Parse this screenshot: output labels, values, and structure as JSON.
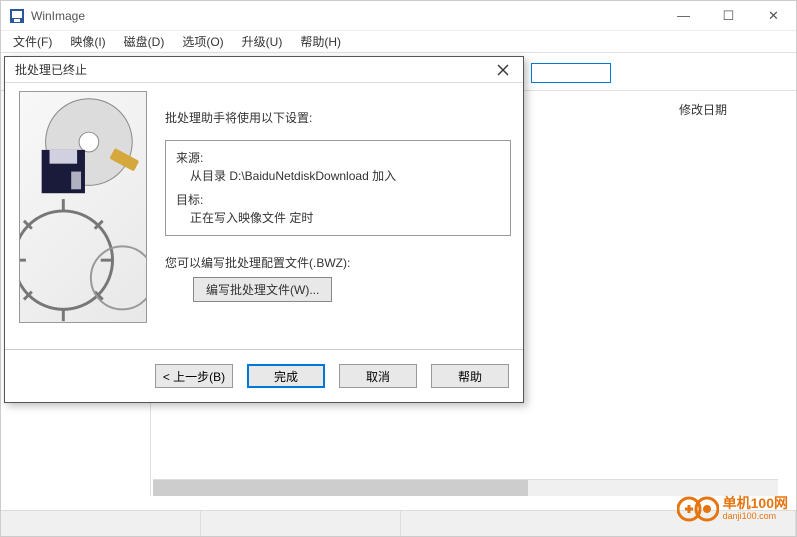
{
  "window": {
    "title": "WinImage",
    "controls": {
      "min": "—",
      "max": "☐",
      "close": "✕"
    }
  },
  "menu": {
    "items": [
      "文件(F)",
      "映像(I)",
      "磁盘(D)",
      "选项(O)",
      "升级(U)",
      "帮助(H)"
    ]
  },
  "columns": {
    "modified": "修改日期"
  },
  "dialog": {
    "title": "批处理已终止",
    "intro": "批处理助手将使用以下设置:",
    "source_label": "来源:",
    "source_value": "从目录 D:\\BaiduNetdiskDownload 加入",
    "target_label": "目标:",
    "target_value": "正在写入映像文件 定时",
    "config_label": "您可以编写批处理配置文件(.BWZ):",
    "write_button": "编写批处理文件(W)...",
    "buttons": {
      "back": "< 上一步(B)",
      "finish": "完成",
      "cancel": "取消",
      "help": "帮助"
    }
  },
  "watermark": {
    "name": "单机100网",
    "url": "danji100.com"
  }
}
